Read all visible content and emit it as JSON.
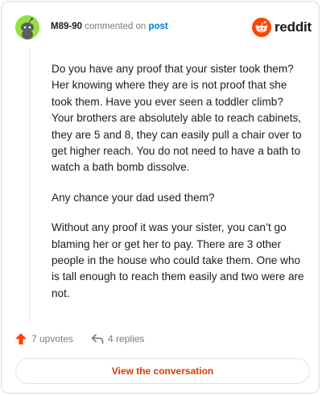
{
  "header": {
    "username": "M89-90",
    "action_text": "commented on",
    "post_link": "post",
    "brand": "reddit"
  },
  "icons": {
    "avatar": "snoo-avatar-icon",
    "logo": "reddit-snoo-icon",
    "upvote": "upvote-arrow-icon",
    "reply": "reply-arrow-icon"
  },
  "colors": {
    "avatar_bg": "#94e044",
    "brand": "#ff4500",
    "upvote": "#ff4500",
    "link": "#0079d3",
    "cta_text": "#d93a00"
  },
  "comment": {
    "paragraphs": [
      "Do you have any proof that your sister took them? Her knowing where they are is not proof that she took them. Have you ever seen a toddler climb? Your brothers are absolutely able to reach cabinets, they are 5 and 8, they can easily pull a chair over to get higher reach. You do not need to have a bath to watch a bath bomb dissolve.",
      "Any chance your dad used them?",
      "Without any proof it was your sister, you can’t go blaming her or get her to pay. There are 3 other people in the house who could take them. One who is tall enough to reach them easily and two were are not."
    ]
  },
  "footer": {
    "upvotes": "7 upvotes",
    "replies": "4 replies"
  },
  "cta": {
    "label": "View the conversation"
  }
}
